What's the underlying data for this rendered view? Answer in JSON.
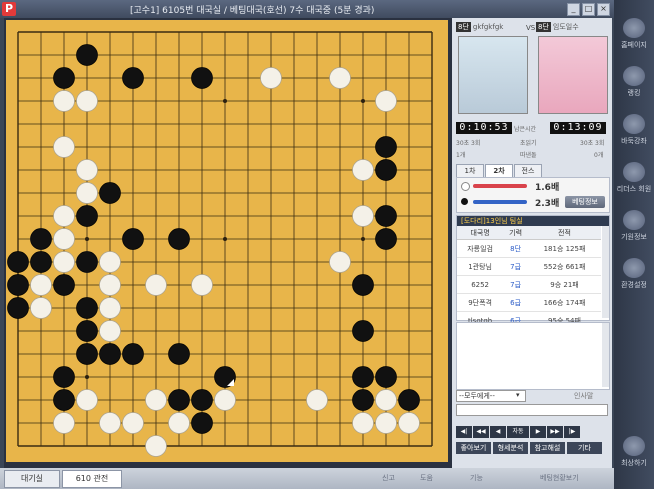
{
  "window": {
    "logo": "P",
    "title": "[고수1] 6105번 대국실 / 베팅대국(호선) 7수 대국중 (5분 경과)",
    "buttons": [
      "_",
      "□",
      "×"
    ]
  },
  "right_sidebar": [
    {
      "label": "홈페이지",
      "icon": "home-icon"
    },
    {
      "label": "랭킹",
      "icon": "trophy-icon"
    },
    {
      "label": "바둑강좌",
      "icon": "book-icon"
    },
    {
      "label": "리더스 회원",
      "icon": "member-icon"
    },
    {
      "label": "기원정보",
      "icon": "info-icon"
    },
    {
      "label": "환경설정",
      "icon": "gear-icon"
    },
    {
      "label": "최상하기",
      "icon": "arrow-icon"
    }
  ],
  "players": {
    "left": {
      "rank": "8단",
      "name": "gkfgkfgk",
      "time": "0:10:53",
      "byoyomi": "30초 3회",
      "captures": "1개"
    },
    "right": {
      "rank": "8단",
      "name": "임도일수",
      "time": "0:13:09",
      "byoyomi": "30초 3회",
      "captures": "0개"
    },
    "vs": "VS",
    "mid_labels": {
      "remain": "남은시간",
      "byo": "초읽기",
      "cap": "따낸돌"
    }
  },
  "tabs": [
    "1차",
    "2차",
    "전스"
  ],
  "betting": {
    "black_score": "1.6배",
    "white_score": "2.3배",
    "button": "베팅정보"
  },
  "room_list": {
    "header": "[도다리]13인님 팀실",
    "columns": [
      "대국명",
      "기력",
      "전적"
    ],
    "rows": [
      {
        "name": "자룡일검",
        "level": "8단",
        "record": "181승 125패"
      },
      {
        "name": "1관탕님",
        "level": "7급",
        "record": "552승 661패"
      },
      {
        "name": "6252",
        "level": "7급",
        "record": "9승 21패"
      },
      {
        "name": "9단폭격",
        "level": "6급",
        "record": "166승 174패"
      },
      {
        "name": "tlsotgh",
        "level": "6급",
        "record": "95승 54패"
      }
    ]
  },
  "chat": {
    "target": "--모두에게--",
    "greeting": "인사말"
  },
  "nav_buttons": [
    "◀|",
    "◀◀",
    "◀",
    "자동",
    "▶",
    "▶▶",
    "|▶"
  ],
  "action_buttons": [
    "좋아보기",
    "형세분석",
    "참고해설",
    "기타"
  ],
  "status_bar": {
    "tab1": "대기실",
    "tab2": "610 관전",
    "items": [
      "신고",
      "도움",
      "기능",
      "베팅현황보기"
    ]
  },
  "board": {
    "size": 19,
    "black": [
      [
        3,
        1
      ],
      [
        2,
        2
      ],
      [
        5,
        2
      ],
      [
        8,
        2
      ],
      [
        16,
        5
      ],
      [
        16,
        6
      ],
      [
        4,
        7
      ],
      [
        3,
        8
      ],
      [
        16,
        8
      ],
      [
        1,
        9
      ],
      [
        5,
        9
      ],
      [
        7,
        9
      ],
      [
        16,
        9
      ],
      [
        0,
        10
      ],
      [
        1,
        10
      ],
      [
        3,
        10
      ],
      [
        0,
        11
      ],
      [
        2,
        11
      ],
      [
        15,
        11
      ],
      [
        0,
        12
      ],
      [
        3,
        12
      ],
      [
        3,
        13
      ],
      [
        15,
        13
      ],
      [
        3,
        14
      ],
      [
        4,
        14
      ],
      [
        5,
        14
      ],
      [
        7,
        14
      ],
      [
        2,
        15
      ],
      [
        15,
        15
      ],
      [
        16,
        15
      ],
      [
        2,
        16
      ],
      [
        7,
        16
      ],
      [
        8,
        16
      ],
      [
        15,
        16
      ],
      [
        17,
        16
      ],
      [
        8,
        17
      ],
      [
        9,
        15
      ]
    ],
    "white": [
      [
        11,
        2
      ],
      [
        14,
        2
      ],
      [
        2,
        3
      ],
      [
        3,
        3
      ],
      [
        16,
        3
      ],
      [
        2,
        5
      ],
      [
        3,
        6
      ],
      [
        15,
        6
      ],
      [
        3,
        7
      ],
      [
        2,
        8
      ],
      [
        15,
        8
      ],
      [
        1,
        9
      ],
      [
        2,
        9
      ],
      [
        14,
        10
      ],
      [
        3,
        10
      ],
      [
        2,
        10
      ],
      [
        4,
        10
      ],
      [
        1,
        11
      ],
      [
        4,
        11
      ],
      [
        6,
        11
      ],
      [
        8,
        11
      ],
      [
        1,
        12
      ],
      [
        4,
        12
      ],
      [
        4,
        13
      ],
      [
        3,
        16
      ],
      [
        6,
        16
      ],
      [
        9,
        16
      ],
      [
        13,
        16
      ],
      [
        16,
        16
      ],
      [
        2,
        17
      ],
      [
        4,
        17
      ],
      [
        5,
        17
      ],
      [
        7,
        17
      ],
      [
        15,
        17
      ],
      [
        16,
        17
      ],
      [
        17,
        17
      ],
      [
        6,
        18
      ]
    ],
    "last_move": [
      9,
      15
    ]
  }
}
